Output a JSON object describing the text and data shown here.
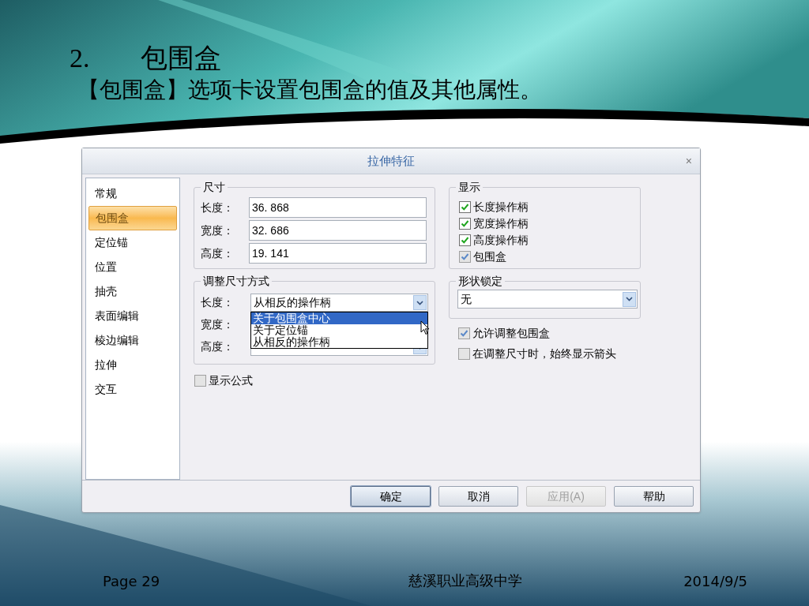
{
  "slide": {
    "number": "2.",
    "title": "包围盒",
    "subtitle": "【包围盒】选项卡设置包围盒的值及其他属性。"
  },
  "dialog": {
    "title": "拉伸特征",
    "close": "×",
    "sidebar": [
      {
        "label": "常规",
        "selected": false
      },
      {
        "label": "包围盒",
        "selected": true
      },
      {
        "label": "定位锚",
        "selected": false
      },
      {
        "label": "位置",
        "selected": false
      },
      {
        "label": "抽壳",
        "selected": false
      },
      {
        "label": "表面编辑",
        "selected": false
      },
      {
        "label": "棱边编辑",
        "selected": false
      },
      {
        "label": "拉伸",
        "selected": false
      },
      {
        "label": "交互",
        "selected": false
      }
    ],
    "size_group": {
      "title": "尺寸",
      "fields": [
        {
          "label": "长度：",
          "value": "36. 868"
        },
        {
          "label": "宽度：",
          "value": "32. 686"
        },
        {
          "label": "高度：",
          "value": "19. 141"
        }
      ]
    },
    "resize_group": {
      "title": "调整尺寸方式",
      "fields": [
        {
          "kind": "dropdown",
          "label": "长度：",
          "value": "从相反的操作柄",
          "expanded": true
        },
        {
          "kind": "label",
          "label": "宽度："
        },
        {
          "kind": "dropdown",
          "label": "高度：",
          "expanded": false
        }
      ],
      "options": [
        {
          "label": "关于包围盒中心",
          "selected": true
        },
        {
          "label": "关于定位锚",
          "selected": false
        },
        {
          "label": "从相反的操作柄",
          "selected": false
        }
      ]
    },
    "show_formula": {
      "label": "显示公式",
      "checked": false,
      "disabled": true
    },
    "display_group": {
      "title": "显示",
      "items": [
        {
          "label": "长度操作柄",
          "checked": true,
          "disabled": false
        },
        {
          "label": "宽度操作柄",
          "checked": true,
          "disabled": false
        },
        {
          "label": "高度操作柄",
          "checked": true,
          "disabled": false
        },
        {
          "label": "包围盒",
          "checked": true,
          "disabled": true
        }
      ]
    },
    "shape_lock": {
      "title": "形状锁定",
      "value": "无"
    },
    "options": [
      {
        "label": "允许调整包围盒",
        "checked": true,
        "disabled": true
      },
      {
        "label": "在调整尺寸时，始终显示箭头",
        "checked": false,
        "disabled": true
      }
    ],
    "buttons": [
      {
        "label": "确定",
        "default": true,
        "disabled": false
      },
      {
        "label": "取消",
        "default": false,
        "disabled": false
      },
      {
        "label": "应用(A)",
        "default": false,
        "disabled": true
      },
      {
        "label": "帮助",
        "default": false,
        "disabled": false
      }
    ]
  },
  "footer": {
    "page": "Page 29",
    "school": "慈溪职业高级中学",
    "date": "2014/9/5"
  }
}
